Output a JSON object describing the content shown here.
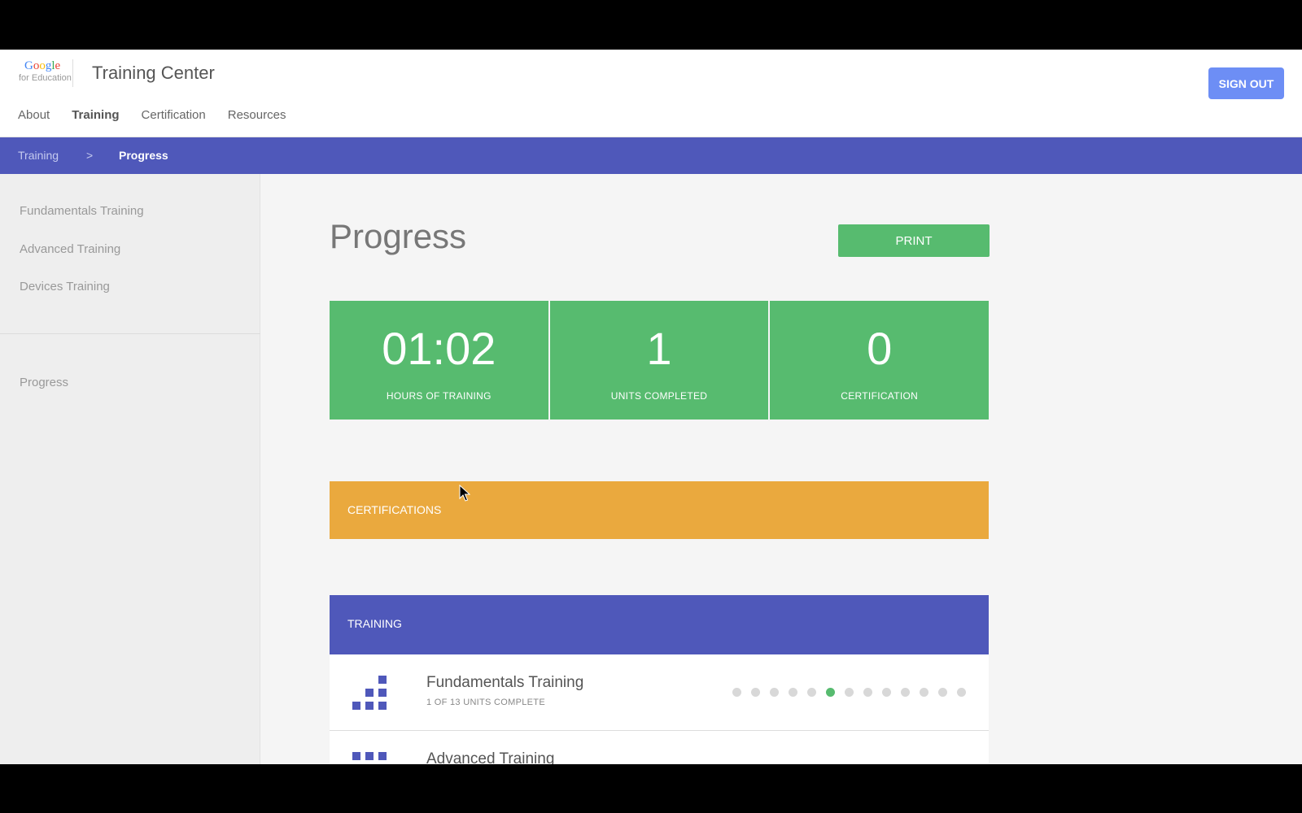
{
  "header": {
    "logo_top": "Google",
    "logo_bottom": "for Education",
    "app_title": "Training Center",
    "signout_label": "SIGN OUT",
    "nav": [
      "About",
      "Training",
      "Certification",
      "Resources"
    ],
    "active_nav": "Training"
  },
  "breadcrumb": {
    "parent": "Training",
    "separator": ">",
    "current": "Progress"
  },
  "sidebar": {
    "items": [
      "Fundamentals Training",
      "Advanced Training",
      "Devices Training"
    ],
    "progress_label": "Progress"
  },
  "main": {
    "title": "Progress",
    "print_label": "PRINT",
    "stats": [
      {
        "value": "01:02",
        "label": "HOURS OF TRAINING"
      },
      {
        "value": "1",
        "label": "UNITS COMPLETED"
      },
      {
        "value": "0",
        "label": "CERTIFICATION"
      }
    ],
    "certifications_label": "CERTIFICATIONS",
    "training_label": "TRAINING",
    "trainings": [
      {
        "title": "Fundamentals Training",
        "subtitle": "1 OF 13 UNITS COMPLETE",
        "total_units": 13,
        "completed_index": 5
      },
      {
        "title": "Advanced Training"
      }
    ]
  },
  "colors": {
    "brand_blue": "#4f58ba",
    "green": "#57bb6f",
    "orange": "#eaa93e",
    "signout_blue": "#6d8ef5"
  }
}
